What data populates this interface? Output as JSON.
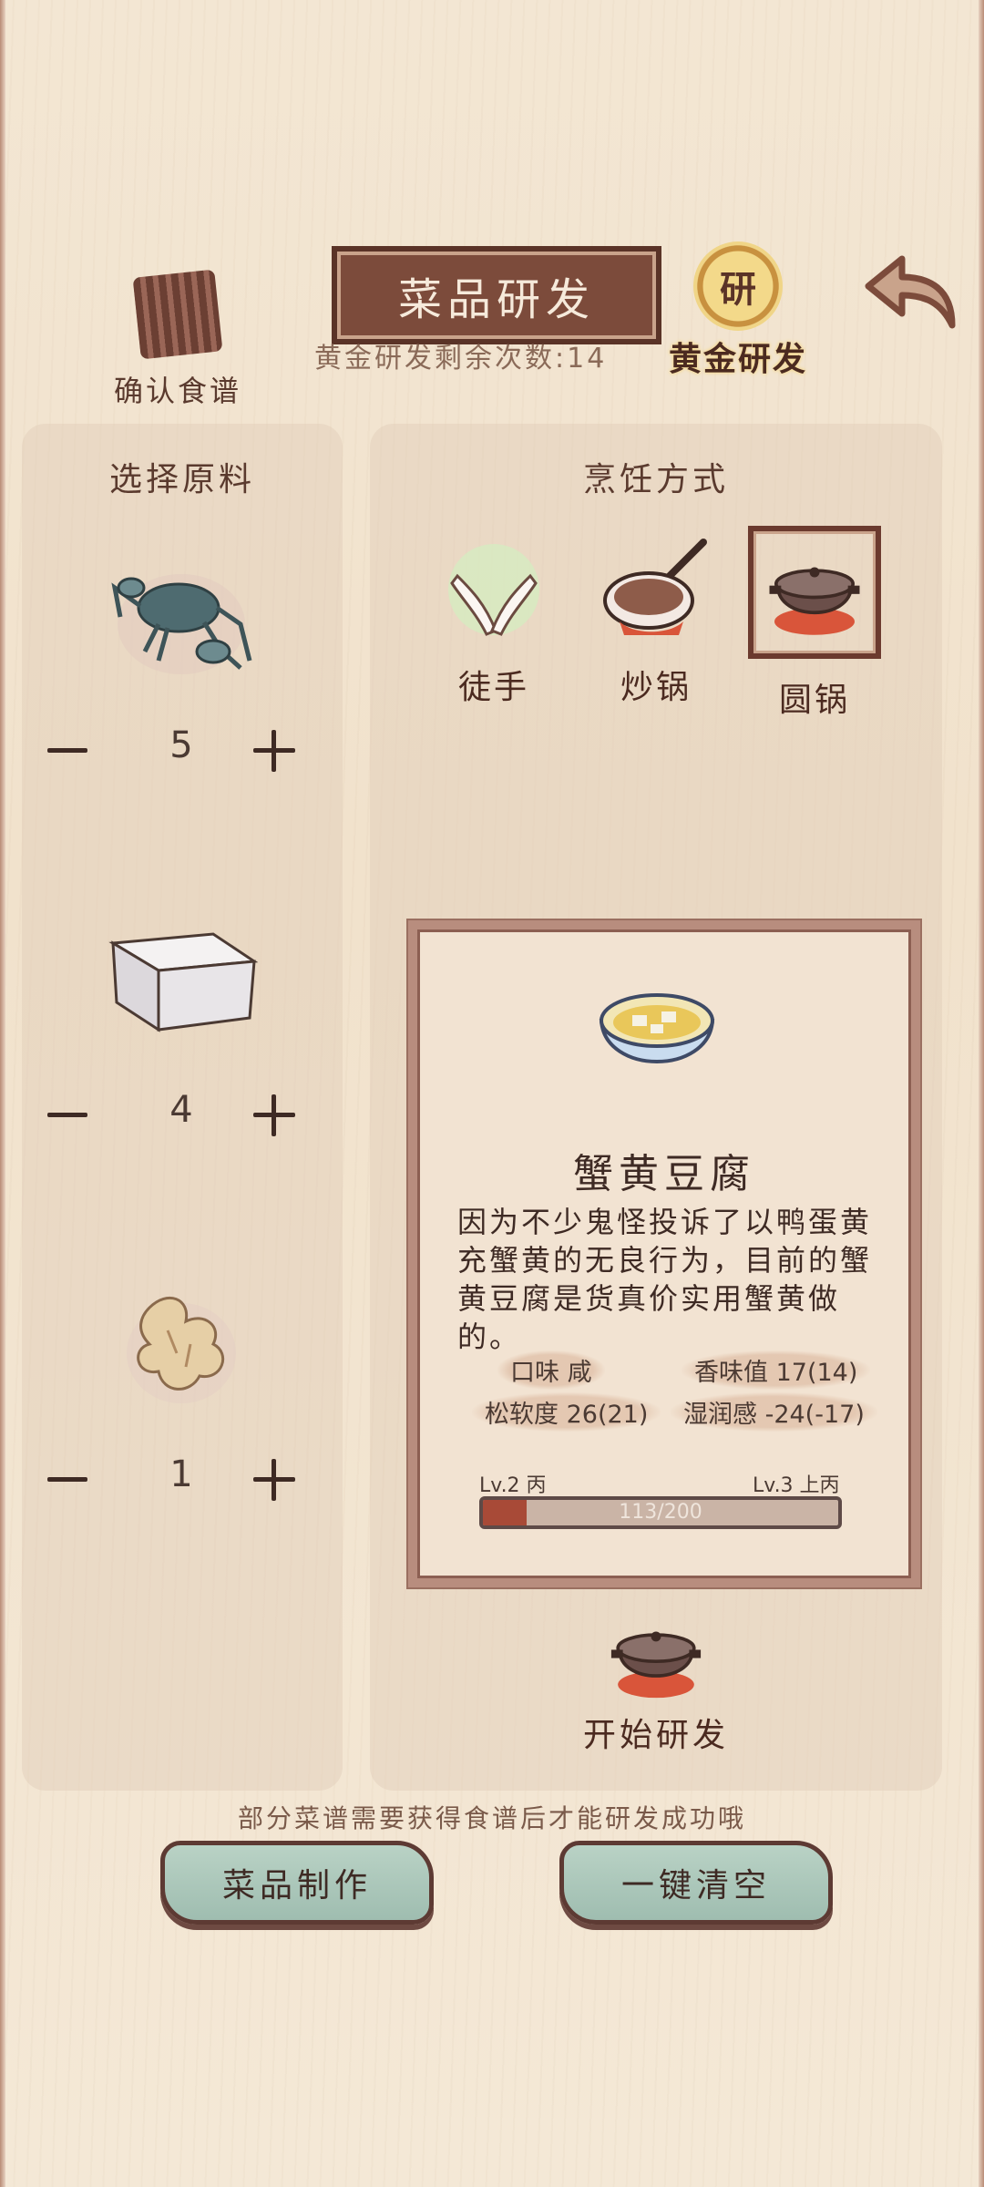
{
  "header": {
    "title": "菜品研发",
    "remaining_label": "黄金研发剩余次数:14",
    "confirm_recipe_label": "确认食谱",
    "gold_research_label": "黄金研发",
    "gold_badge_glyph": "研"
  },
  "ingredients_panel": {
    "title": "选择原料",
    "items": [
      {
        "name": "crab",
        "quantity": "5"
      },
      {
        "name": "tofu",
        "quantity": "4"
      },
      {
        "name": "ginger",
        "quantity": "1"
      }
    ]
  },
  "cooking_panel": {
    "title": "烹饪方式",
    "methods": [
      {
        "label": "徒手",
        "selected": false
      },
      {
        "label": "炒锅",
        "selected": false
      },
      {
        "label": "圆锅",
        "selected": true
      }
    ]
  },
  "result": {
    "dish_name": "蟹黄豆腐",
    "description": "因为不少鬼怪投诉了以鸭蛋黄充蟹黄的无良行为，目前的蟹黄豆腐是货真价实用蟹黄做的。",
    "stats": {
      "taste": "口味 咸",
      "aroma": "香味值 17(14)",
      "softness": "松软度 26(21)",
      "moisture": "湿润感 -24(-17)"
    },
    "level_from": "Lv.2 丙",
    "level_to": "Lv.3 上丙",
    "progress_text": "113/200",
    "progress": 0.565
  },
  "start_label": "开始研发",
  "footer": {
    "hint": "部分菜谱需要获得食谱后才能研发成功哦",
    "make_dish_label": "菜品制作",
    "clear_all_label": "一键清空"
  }
}
